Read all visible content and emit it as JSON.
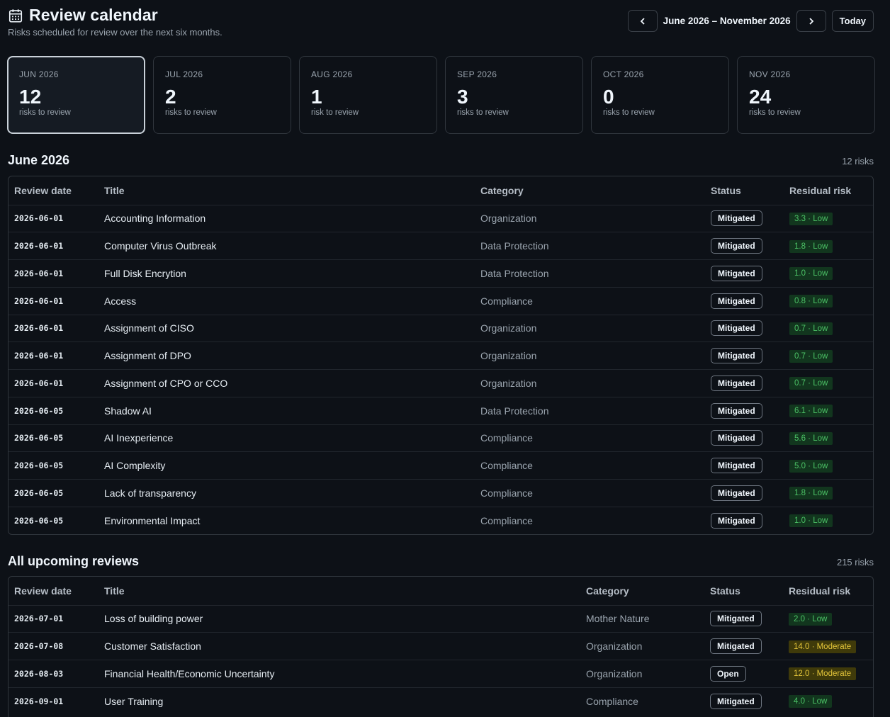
{
  "header": {
    "title": "Review calendar",
    "subtitle": "Risks scheduled for review over the next six months.",
    "range": "June 2026 – November 2026",
    "today_label": "Today"
  },
  "months": [
    {
      "label": "JUN 2026",
      "count": "12",
      "sub": "risks to review",
      "active": true
    },
    {
      "label": "JUL 2026",
      "count": "2",
      "sub": "risks to review"
    },
    {
      "label": "AUG 2026",
      "count": "1",
      "sub": "risk to review"
    },
    {
      "label": "SEP 2026",
      "count": "3",
      "sub": "risks to review"
    },
    {
      "label": "OCT 2026",
      "count": "0",
      "sub": "risks to review"
    },
    {
      "label": "NOV 2026",
      "count": "24",
      "sub": "risks to review"
    }
  ],
  "june_section": {
    "title": "June 2026",
    "count": "12 risks",
    "columns": [
      "Review date",
      "Title",
      "Category",
      "Status",
      "Residual risk"
    ],
    "rows": [
      {
        "date": "2026-06-01",
        "title": "Accounting Information",
        "category": "Organization",
        "status": "Mitigated",
        "risk": "3.3 · Low",
        "level": "low"
      },
      {
        "date": "2026-06-01",
        "title": "Computer Virus Outbreak",
        "category": "Data Protection",
        "status": "Mitigated",
        "risk": "1.8 · Low",
        "level": "low"
      },
      {
        "date": "2026-06-01",
        "title": "Full Disk Encrytion",
        "category": "Data Protection",
        "status": "Mitigated",
        "risk": "1.0 · Low",
        "level": "low"
      },
      {
        "date": "2026-06-01",
        "title": "Access",
        "category": "Compliance",
        "status": "Mitigated",
        "risk": "0.8 · Low",
        "level": "low"
      },
      {
        "date": "2026-06-01",
        "title": "Assignment of CISO",
        "category": "Organization",
        "status": "Mitigated",
        "risk": "0.7 · Low",
        "level": "low"
      },
      {
        "date": "2026-06-01",
        "title": "Assignment of DPO",
        "category": "Organization",
        "status": "Mitigated",
        "risk": "0.7 · Low",
        "level": "low"
      },
      {
        "date": "2026-06-01",
        "title": "Assignment of CPO or CCO",
        "category": "Organization",
        "status": "Mitigated",
        "risk": "0.7 · Low",
        "level": "low"
      },
      {
        "date": "2026-06-05",
        "title": "Shadow AI",
        "category": "Data Protection",
        "status": "Mitigated",
        "risk": "6.1 · Low",
        "level": "low"
      },
      {
        "date": "2026-06-05",
        "title": "AI Inexperience",
        "category": "Compliance",
        "status": "Mitigated",
        "risk": "5.6 · Low",
        "level": "low"
      },
      {
        "date": "2026-06-05",
        "title": "AI Complexity",
        "category": "Compliance",
        "status": "Mitigated",
        "risk": "5.0 · Low",
        "level": "low"
      },
      {
        "date": "2026-06-05",
        "title": "Lack of transparency",
        "category": "Compliance",
        "status": "Mitigated",
        "risk": "1.8 · Low",
        "level": "low"
      },
      {
        "date": "2026-06-05",
        "title": "Environmental Impact",
        "category": "Compliance",
        "status": "Mitigated",
        "risk": "1.0 · Low",
        "level": "low"
      }
    ]
  },
  "upcoming_section": {
    "title": "All upcoming reviews",
    "count": "215 risks",
    "columns": [
      "Review date",
      "Title",
      "Category",
      "Status",
      "Residual risk"
    ],
    "rows": [
      {
        "date": "2026-07-01",
        "title": "Loss of building power",
        "category": "Mother Nature",
        "status": "Mitigated",
        "risk": "2.0 · Low",
        "level": "low"
      },
      {
        "date": "2026-07-08",
        "title": "Customer Satisfaction",
        "category": "Organization",
        "status": "Mitigated",
        "risk": "14.0 · Moderate",
        "level": "mod"
      },
      {
        "date": "2026-08-03",
        "title": "Financial Health/Economic Uncertainty",
        "category": "Organization",
        "status": "Open",
        "risk": "12.0 · Moderate",
        "level": "mod"
      },
      {
        "date": "2026-09-01",
        "title": "User Training",
        "category": "Compliance",
        "status": "Mitigated",
        "risk": "4.0 · Low",
        "level": "low"
      }
    ]
  },
  "colors": {
    "low_bg": "#12361e",
    "low_fg": "#4cc266",
    "moderate_bg": "#3f3a0a",
    "moderate_fg": "#e3c53a",
    "background": "#0d1117"
  }
}
